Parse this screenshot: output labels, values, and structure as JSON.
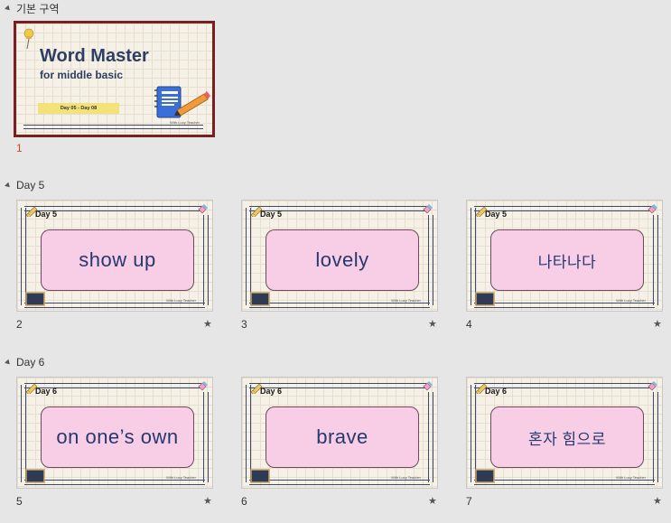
{
  "sections": [
    {
      "name": "기본 구역"
    },
    {
      "name": "Day 5"
    },
    {
      "name": "Day 6"
    }
  ],
  "title_slide": {
    "number": "1",
    "title": "Word Master",
    "subtitle": "for middle basic",
    "date_range": "Day 05 - Day 08",
    "credit": "With Lucy Teacher"
  },
  "slides": [
    {
      "number": "2",
      "day": "Day 5",
      "word": "show up",
      "credit": "With Lucy Teacher",
      "star": "★"
    },
    {
      "number": "3",
      "day": "Day 5",
      "word": "lovely",
      "credit": "With Lucy Teacher",
      "star": "★"
    },
    {
      "number": "4",
      "day": "Day 5",
      "word": "나타나다",
      "credit": "With Lucy Teacher",
      "star": "★"
    },
    {
      "number": "5",
      "day": "Day 6",
      "word": "on one’s own",
      "credit": "With Lucy Teacher",
      "star": "★"
    },
    {
      "number": "6",
      "day": "Day 6",
      "word": "brave",
      "credit": "With Lucy Teacher",
      "star": "★"
    },
    {
      "number": "7",
      "day": "Day 6",
      "word": "혼자 힘으로",
      "credit": "With Lucy Teacher",
      "star": "★"
    }
  ],
  "colors": {
    "selected_border": "#7a1f1f",
    "word_card": "#f8cde6",
    "word_text": "#243a6e",
    "active_number": "#d24726"
  }
}
